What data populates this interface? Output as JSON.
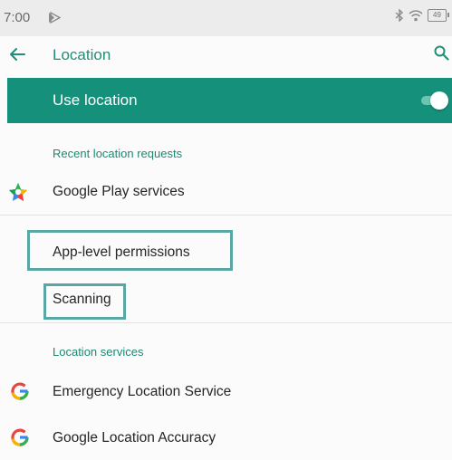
{
  "status_bar": {
    "time": "7:00",
    "battery_level": "49",
    "icons": [
      "play-store-notification-icon",
      "bluetooth-icon",
      "wifi-icon",
      "battery-icon"
    ]
  },
  "toolbar": {
    "title": "Location",
    "back_icon": "back-arrow-icon",
    "search_icon": "search-icon"
  },
  "master_switch": {
    "label": "Use location",
    "state": "on"
  },
  "recent_requests": {
    "header": "Recent location requests",
    "items": [
      {
        "label": "Google Play services",
        "icon": "google-play-services-icon"
      }
    ]
  },
  "settings_items": [
    {
      "label": "App-level permissions",
      "highlighted": true
    },
    {
      "label": "Scanning",
      "highlighted": true
    }
  ],
  "location_services": {
    "header": "Location services",
    "items": [
      {
        "label": "Emergency Location Service",
        "icon": "google-g-icon"
      },
      {
        "label": "Google Location Accuracy",
        "icon": "google-g-icon"
      }
    ]
  },
  "colors": {
    "accent": "#15907a",
    "accent_text": "#1a8a74",
    "highlight_border": "#5aa6a4",
    "status_bar_bg": "#ececec"
  }
}
